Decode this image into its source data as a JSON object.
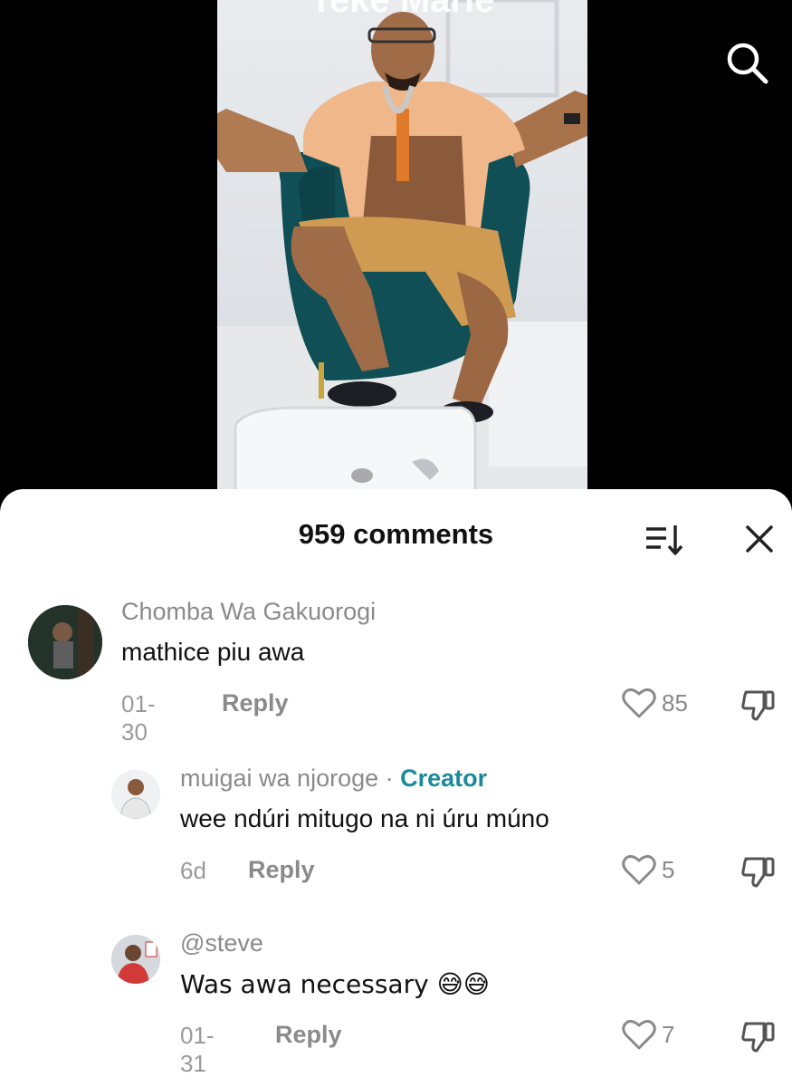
{
  "video": {
    "overlay_title": "Teke Marie",
    "search_icon": "search-icon"
  },
  "comments_header": {
    "title": "959 comments",
    "sort_icon": "sort-icon",
    "close_icon": "close-icon"
  },
  "comments": [
    {
      "author": "Chomba Wa Gakuorogi",
      "text": "mathice piu awa",
      "date": "01-30",
      "reply_label": "Reply",
      "likes": "85"
    },
    {
      "author": "muigai wa njoroge",
      "separator": " · ",
      "badge": "Creator",
      "text": "wee ndúri mitugo na ni úru múno",
      "date": "6d",
      "reply_label": "Reply",
      "likes": "5"
    },
    {
      "author": "@steve",
      "text": "Was awa necessary 😅😅",
      "date": "01-31",
      "reply_label": "Reply",
      "likes": "7"
    }
  ],
  "colors": {
    "creator_badge": "#1a8a9a",
    "muted_text": "#8a8a8a"
  }
}
